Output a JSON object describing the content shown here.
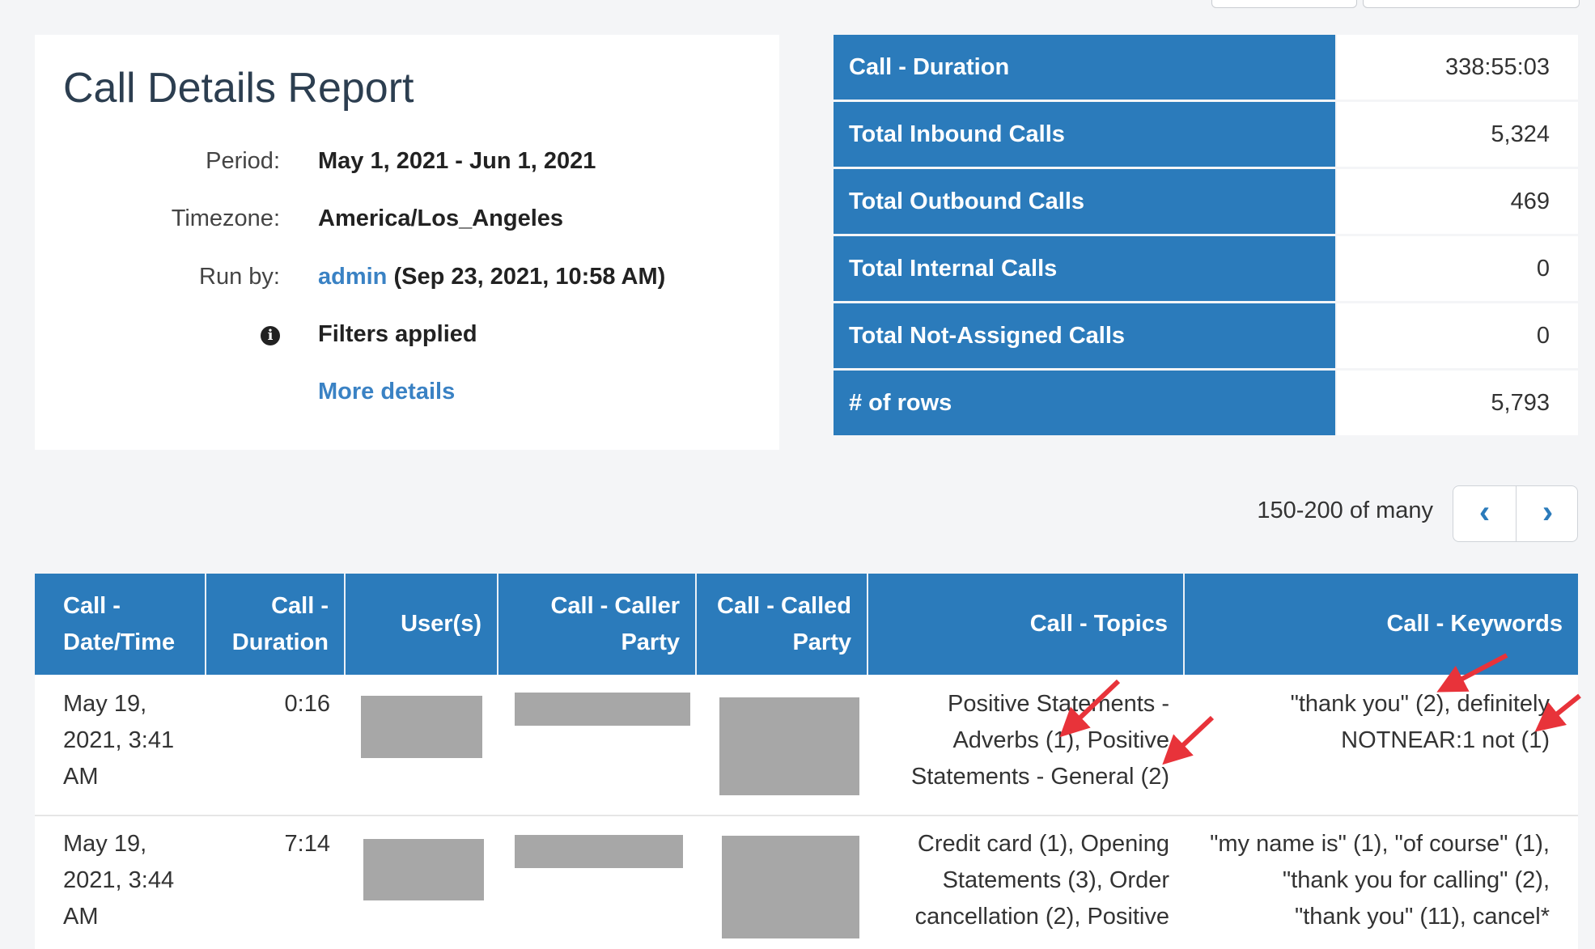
{
  "report": {
    "title": "Call Details Report",
    "period_label": "Period:",
    "period_value": "May 1, 2021 - Jun 1, 2021",
    "timezone_label": "Timezone:",
    "timezone_value": "America/Los_Angeles",
    "runby_label": "Run by:",
    "runby_user": "admin",
    "runby_time": "(Sep 23, 2021, 10:58 AM)",
    "filters_icon": "info-icon",
    "filters_label": "Filters applied",
    "more_details": "More details"
  },
  "summary": [
    {
      "label": "Call - Duration",
      "value": "338:55:03"
    },
    {
      "label": "Total Inbound Calls",
      "value": "5,324"
    },
    {
      "label": "Total Outbound Calls",
      "value": "469"
    },
    {
      "label": "Total Internal Calls",
      "value": "0"
    },
    {
      "label": "Total Not-Assigned Calls",
      "value": "0"
    },
    {
      "label": "# of rows",
      "value": "5,793"
    }
  ],
  "pagination": {
    "info": "150-200 of many",
    "prev_icon": "chevron-left-icon",
    "next_icon": "chevron-right-icon",
    "prev_glyph": "‹",
    "next_glyph": "›"
  },
  "table": {
    "columns": [
      {
        "line1": "Call -",
        "line2": "Date/Time"
      },
      {
        "line1": "Call -",
        "line2": "Duration"
      },
      {
        "line1": "User(s)",
        "line2": ""
      },
      {
        "line1": "Call - Caller",
        "line2": "Party"
      },
      {
        "line1": "Call - Called",
        "line2": "Party"
      },
      {
        "line1": "Call - Topics",
        "line2": ""
      },
      {
        "line1": "Call - Keywords",
        "line2": ""
      }
    ],
    "rows": [
      {
        "datetime": [
          "May 19,",
          "2021, 3:41",
          "AM"
        ],
        "duration": "0:16",
        "topics": [
          "Positive Statements -",
          "Adverbs (1), Positive",
          "Statements - General (2)"
        ],
        "keywords": [
          "\"thank you\" (2), definitely",
          "NOTNEAR:1 not (1)"
        ]
      },
      {
        "datetime": [
          "May 19,",
          "2021, 3:44",
          "AM"
        ],
        "duration": "7:14",
        "topics": [
          "Credit card (1), Opening",
          "Statements (3), Order",
          "cancellation (2), Positive"
        ],
        "keywords": [
          "\"my name is\" (1), \"of course\" (1),",
          "\"thank you for calling\" (2),",
          "\"thank you\" (11), cancel*"
        ]
      }
    ]
  },
  "annotation": {
    "arrow_color": "#e8333a"
  }
}
